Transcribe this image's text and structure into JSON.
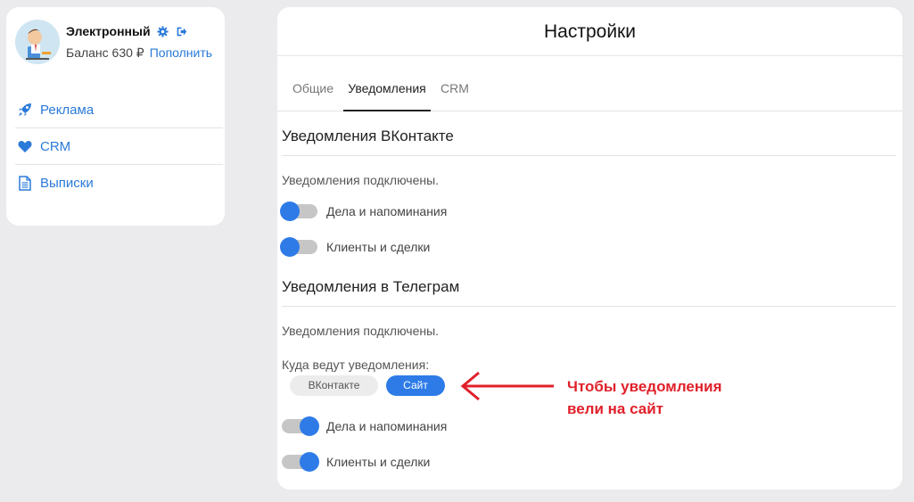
{
  "profile": {
    "name": "Электронный",
    "balance_label": "Баланс 630 ₽",
    "topup_link": "Пополнить"
  },
  "sidebar": {
    "items": [
      {
        "label": "Реклама",
        "icon": "rocket-icon"
      },
      {
        "label": "CRM",
        "icon": "heart-icon"
      },
      {
        "label": "Выписки",
        "icon": "document-icon"
      }
    ]
  },
  "main": {
    "title": "Настройки",
    "tabs": [
      {
        "label": "Общие",
        "active": false
      },
      {
        "label": "Уведомления",
        "active": true
      },
      {
        "label": "CRM",
        "active": false
      }
    ],
    "vk_section": {
      "title": "Уведомления ВКонтакте",
      "status": "Уведомления подключены.",
      "toggles": [
        {
          "label": "Дела и напоминания",
          "on": false
        },
        {
          "label": "Клиенты и сделки",
          "on": false
        }
      ]
    },
    "tg_section": {
      "title": "Уведомления в Телеграм",
      "status": "Уведомления подключены.",
      "destination_label": "Куда ведут уведомления:",
      "destination_options": [
        "ВКонтакте",
        "Сайт"
      ],
      "destination_selected": "Сайт",
      "toggles": [
        {
          "label": "Дела и напоминания",
          "on": true
        },
        {
          "label": "Клиенты и сделки",
          "on": true
        }
      ]
    }
  },
  "annotation": {
    "line1": "Чтобы уведомления",
    "line2": "вели на сайт",
    "color": "#e0202a"
  },
  "colors": {
    "accent": "#2e7be8",
    "link": "#2a7ad9"
  }
}
